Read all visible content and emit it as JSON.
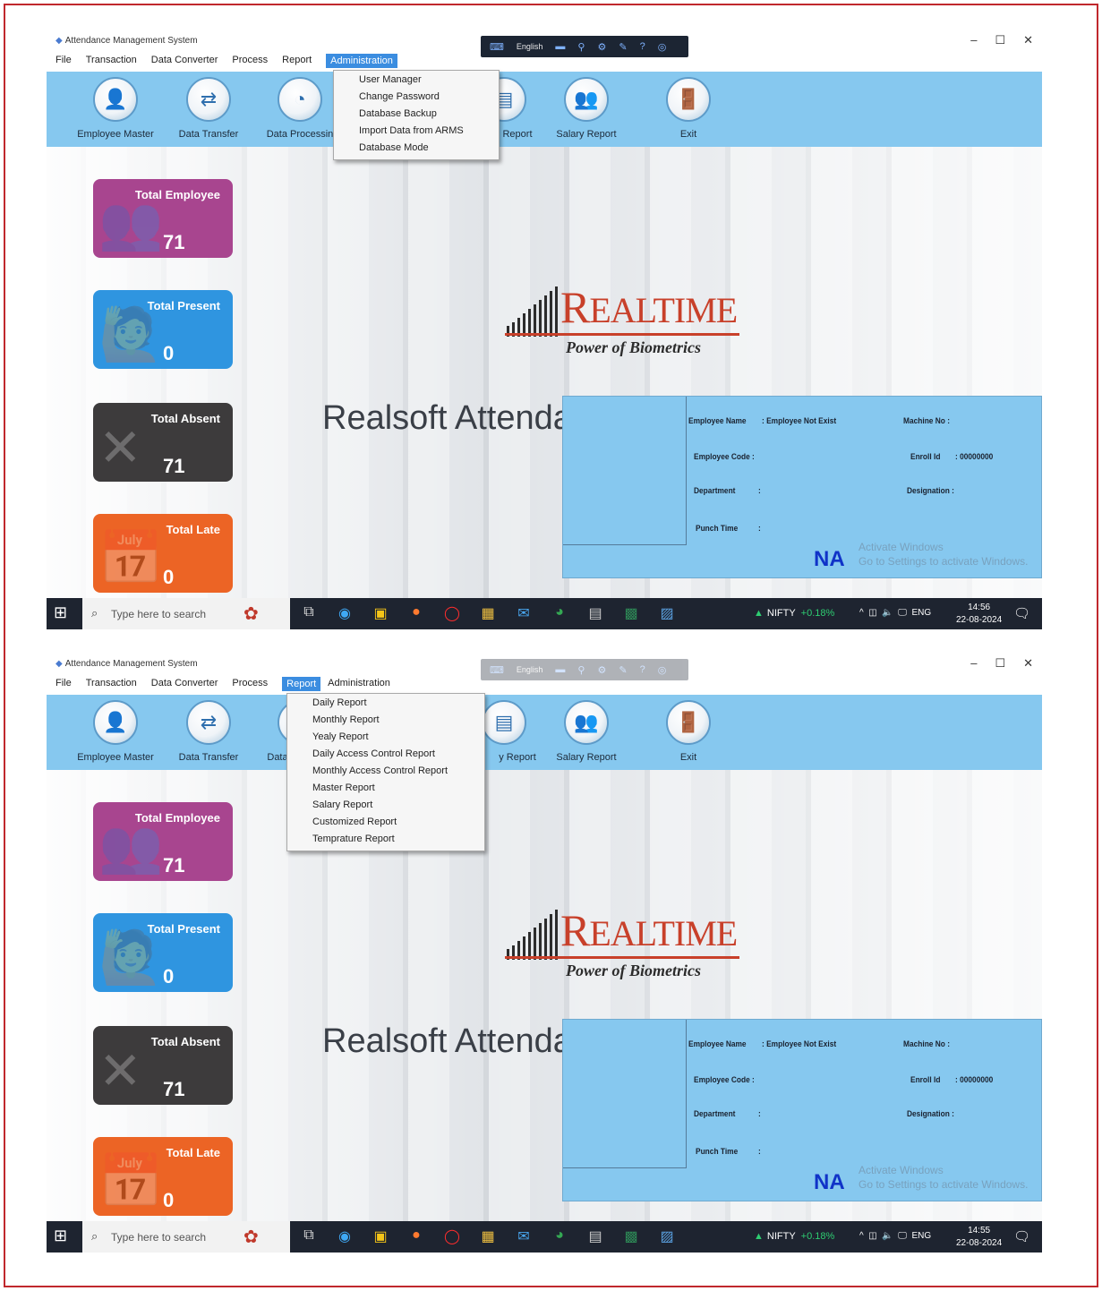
{
  "window": {
    "title": "Attendance Management System",
    "controls": [
      "–",
      "☐",
      "✕"
    ]
  },
  "lang_toolbar": {
    "language": "English"
  },
  "menubar": [
    "File",
    "Transaction",
    "Data Converter",
    "Process",
    "Report",
    "Administration"
  ],
  "toolbar": {
    "employee_master": "Employee Master",
    "data_transfer": "Data Transfer",
    "data_processing": "Data Processin",
    "data_processing_short": "Data",
    "daily_report": "Report",
    "daily_report_short": "y Report",
    "salary_report": "Salary Report",
    "exit": "Exit"
  },
  "administration_menu": [
    "User Manager",
    "Change Password",
    "Database Backup",
    "Import Data from ARMS",
    "Database Mode"
  ],
  "report_menu": [
    "Daily Report",
    "Monthly Report",
    "Yealy Report",
    "Daily Access Control Report",
    "Monthly Access Control Report",
    "Master Report",
    "Salary Report",
    "Customized Report",
    "Temprature Report"
  ],
  "cards": {
    "total_employee": {
      "label": "Total Employee",
      "value": "71"
    },
    "total_present": {
      "label": "Total Present",
      "value": "0"
    },
    "total_absent": {
      "label": "Total Absent",
      "value": "71"
    },
    "total_late": {
      "label": "Total Late",
      "value": "0"
    }
  },
  "logo": {
    "brand_first": "R",
    "brand_rest": "EALTIME",
    "tagline": "Power of Biometrics"
  },
  "app_name": "Realsoft Attenda",
  "info_panel": {
    "employee_name_label": "Employee Name",
    "employee_name_value": ": Employee Not Exist",
    "machine_no_label": "Machine No :",
    "employee_code_label": "Employee Code :",
    "enroll_id_label": "Enroll Id",
    "enroll_id_value": ": 00000000",
    "department_label": "Department",
    "department_value": ":",
    "designation_label": "Designation :",
    "punch_time_label": "Punch Time",
    "punch_time_value": ":",
    "na": "NA",
    "watermark_1": "Activate Windows",
    "watermark_2": "Go to Settings to activate Windows."
  },
  "taskbar": {
    "search_placeholder": "Type here to search",
    "nifty_label": "NIFTY",
    "nifty_change": "+0.18%",
    "tray_lang": "ENG",
    "date": "22-08-2024",
    "time_1": "14:56",
    "time_2": "14:55"
  },
  "colors": {
    "accent_toolbar": "#86c8ef",
    "menu_highlight": "#3b8de0",
    "card_employee": "#a8458f",
    "card_present": "#2f95e0",
    "card_absent": "#3d3b3c",
    "card_late": "#ec6425",
    "brand_red": "#c8402a",
    "frame_border": "#c0282d"
  },
  "icons": {
    "employee_master": "person-icon",
    "data_transfer": "transfer-icon",
    "data_processing": "pie-chart-icon",
    "salary_report": "people-icon",
    "exit": "exit-door-icon"
  }
}
